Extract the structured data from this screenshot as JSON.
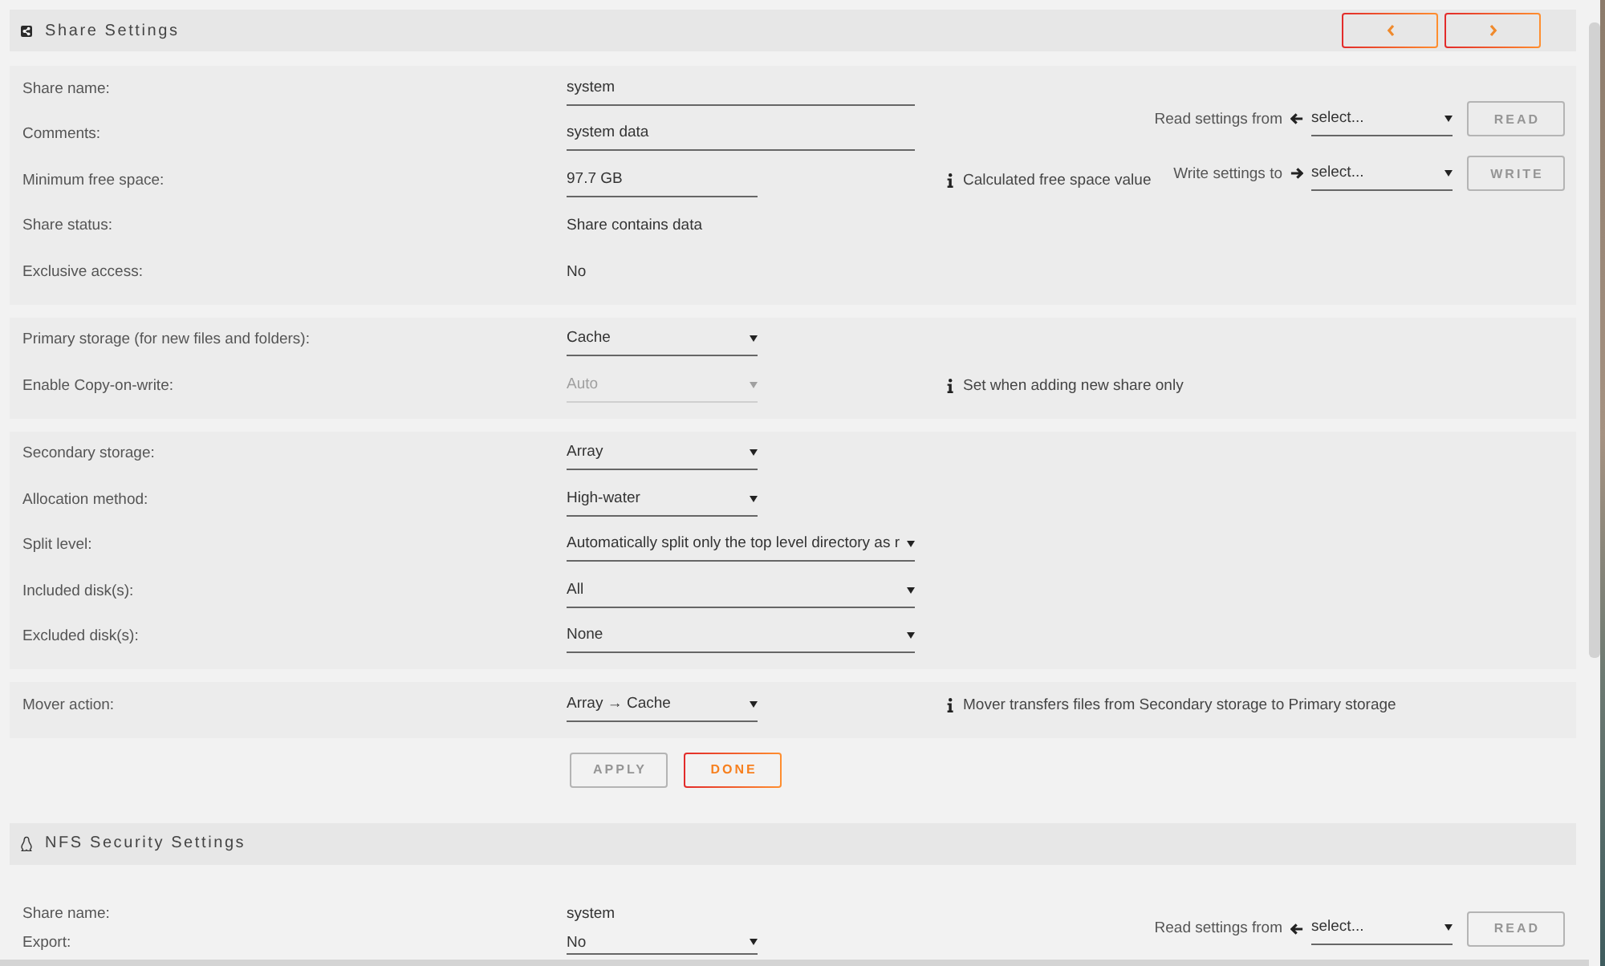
{
  "share_settings": {
    "title": "Share Settings",
    "groups": [
      {
        "rows": [
          {
            "label": "Share name:",
            "kind": "input",
            "value": "system"
          },
          {
            "label": "Comments:",
            "kind": "input",
            "value": "system data"
          },
          {
            "label": "Minimum free space:",
            "kind": "input",
            "value": "97.7 GB",
            "note": "Calculated free space value"
          },
          {
            "label": "Share status:",
            "kind": "text",
            "value": "Share contains data"
          },
          {
            "label": "Exclusive access:",
            "kind": "text",
            "value": "No"
          }
        ],
        "copy_settings": [
          {
            "kind": "read",
            "label": "Read settings from",
            "value": "select...",
            "button": "READ",
            "disabled": true
          },
          {
            "kind": "write",
            "label": "Write settings to",
            "value": "select...",
            "button": "WRITE",
            "disabled": true
          }
        ]
      },
      {
        "rows": [
          {
            "label": "Primary storage (for new files and folders):",
            "kind": "select",
            "value": "Cache",
            "disabled": false
          },
          {
            "label": "Enable Copy-on-write:",
            "kind": "select",
            "value": "Auto",
            "disabled": true,
            "note": "Set when adding new share only"
          }
        ]
      },
      {
        "rows": [
          {
            "label": "Secondary storage:",
            "kind": "select",
            "value": "Array",
            "disabled": false
          },
          {
            "label": "Allocation method:",
            "kind": "select",
            "value": "High-water",
            "disabled": false
          },
          {
            "label": "Split level:",
            "kind": "select",
            "value": "Automatically split only the top level directory as r",
            "disabled": false
          },
          {
            "label": "Included disk(s):",
            "kind": "select",
            "value": "All",
            "disabled": false
          },
          {
            "label": "Excluded disk(s):",
            "kind": "select",
            "value": "None",
            "disabled": false
          }
        ]
      },
      {
        "rows": [
          {
            "label": "Mover action:",
            "kind": "select",
            "value": "Array → Cache",
            "disabled": false,
            "note": "Mover transfers files from Secondary storage to Primary storage"
          }
        ]
      }
    ],
    "buttons": [
      {
        "label": "APPLY",
        "disabled": true
      },
      {
        "label": "DONE",
        "disabled": false
      }
    ]
  },
  "nfs_security_settings": {
    "title": "NFS Security Settings",
    "rows": [
      {
        "label": "Share name:",
        "kind": "text",
        "value": "system"
      },
      {
        "label": "Export:",
        "kind": "select",
        "value": "No",
        "disabled": false
      }
    ],
    "copy_settings": [
      {
        "kind": "read",
        "label": "Read settings from",
        "value": "select...",
        "button": "READ",
        "disabled": true
      }
    ]
  }
}
